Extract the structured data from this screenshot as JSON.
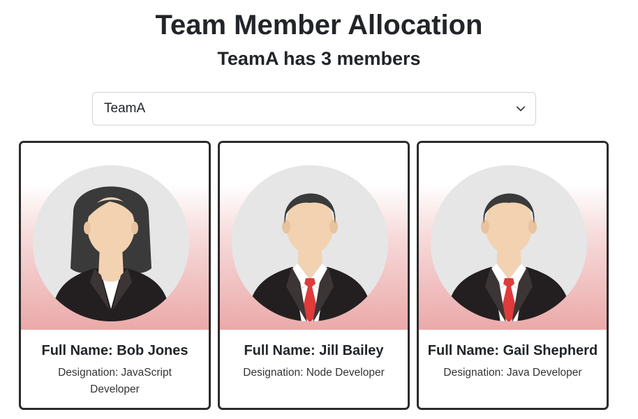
{
  "header": {
    "title": "Team Member Allocation",
    "subtitle": "TeamA has 3 members"
  },
  "team_select": {
    "selected": "TeamA",
    "icon": "chevron-down-icon"
  },
  "members": [
    {
      "full_name": "Full Name: Bob Jones",
      "designation": "Designation: JavaScript Developer",
      "avatar": "female-avatar-icon"
    },
    {
      "full_name": "Full Name: Jill Bailey",
      "designation": "Designation: Node Developer",
      "avatar": "male-avatar-icon"
    },
    {
      "full_name": "Full Name: Gail Shepherd",
      "designation": "Designation: Java Developer",
      "avatar": "male-avatar-icon"
    }
  ],
  "colors": {
    "card_border": "#2b2b2b",
    "gradient_bottom": "#eba9a9",
    "tie": "#e03a3a",
    "suit": "#231f20",
    "hair": "#3a3a3a",
    "skin": "#f2d2b0",
    "avatar_bg": "#e6e6e6"
  }
}
